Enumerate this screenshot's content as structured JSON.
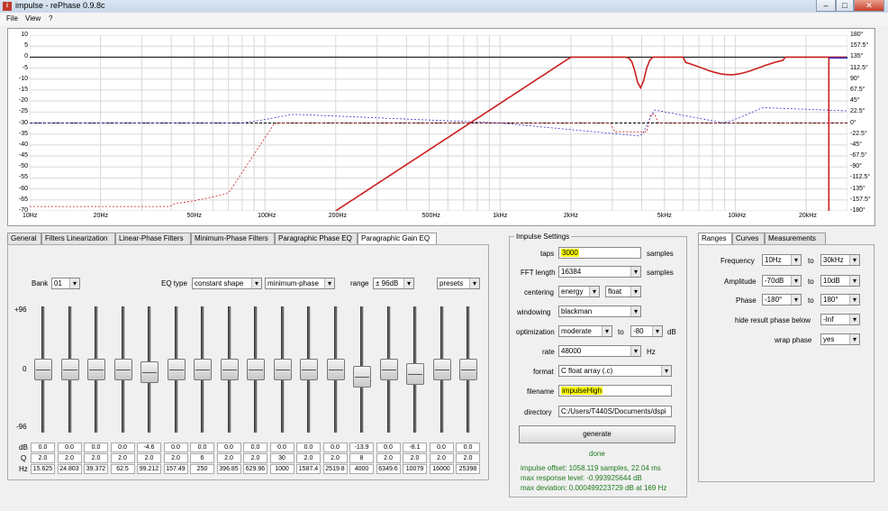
{
  "window": {
    "title": "impulse  -  rePhase 0.9.8c",
    "min_label": "–",
    "max_label": "□",
    "close_label": "✕"
  },
  "menu": [
    "File",
    "View",
    "?"
  ],
  "plot": {
    "y_left_ticks": [
      "10",
      "5",
      "0",
      "-5",
      "-10",
      "-15",
      "-20",
      "-25",
      "-30",
      "-35",
      "-40",
      "-45",
      "-50",
      "-55",
      "-60",
      "-65",
      "-70"
    ],
    "y_right_ticks": [
      "180°",
      "157.5°",
      "135°",
      "112.5°",
      "90°",
      "67.5°",
      "45°",
      "22.5°",
      "0°",
      "-22.5°",
      "-45°",
      "-67.5°",
      "-90°",
      "-112.5°",
      "-135°",
      "-157.5°",
      "-180°"
    ],
    "x_ticks": [
      "10Hz",
      "20Hz",
      "50Hz",
      "100Hz",
      "200Hz",
      "500Hz",
      "1kHz",
      "2kHz",
      "5kHz",
      "10kHz",
      "20kHz"
    ],
    "colors": {
      "red": "#cc1f1f",
      "blue": "#3333cc",
      "grid": "#d8d8d8"
    }
  },
  "tabs": [
    "General",
    "Filters Linearization",
    "Linear-Phase Filters",
    "Minimum-Phase Filters",
    "Paragraphic Phase EQ",
    "Paragraphic Gain EQ"
  ],
  "active_tab": 5,
  "eq": {
    "bank_label": "Bank",
    "bank_value": "01",
    "eqtype_label": "EQ type",
    "eqtype_value": "constant shape",
    "phase_value": "minimum-phase",
    "range_label": "range",
    "range_value": "± 96dB",
    "presets_label": "presets",
    "scale_top": "+96",
    "scale_mid": "0",
    "scale_bottom": "-96",
    "row_labels": {
      "db": "dB",
      "q": "Q",
      "hz": "Hz"
    },
    "bands": [
      {
        "db": "0.0",
        "q": "2.0",
        "hz": "15.625",
        "level": 0
      },
      {
        "db": "0.0",
        "q": "2.0",
        "hz": "24.803",
        "level": 0
      },
      {
        "db": "0.0",
        "q": "2.0",
        "hz": "39.372",
        "level": 0
      },
      {
        "db": "0.0",
        "q": "2.0",
        "hz": "62.5",
        "level": 0
      },
      {
        "db": "-4.6",
        "q": "2.0",
        "hz": "99.212",
        "level": -4.6
      },
      {
        "db": "0.0",
        "q": "2.0",
        "hz": "157.49",
        "level": 0
      },
      {
        "db": "0.0",
        "q": "6",
        "hz": "250",
        "level": 0
      },
      {
        "db": "0.0",
        "q": "2.0",
        "hz": "396.85",
        "level": 0
      },
      {
        "db": "0.0",
        "q": "2.0",
        "hz": "629.96",
        "level": 0
      },
      {
        "db": "0.0",
        "q": "30",
        "hz": "1000",
        "level": 0
      },
      {
        "db": "0.0",
        "q": "2.0",
        "hz": "1587.4",
        "level": 0
      },
      {
        "db": "0.0",
        "q": "2.0",
        "hz": "2519.8",
        "level": 0
      },
      {
        "db": "-13.9",
        "q": "8",
        "hz": "4000",
        "level": -13.9
      },
      {
        "db": "0.0",
        "q": "2.0",
        "hz": "6349.6",
        "level": 0
      },
      {
        "db": "-8.1",
        "q": "2.0",
        "hz": "10079",
        "level": -8.1
      },
      {
        "db": "0.0",
        "q": "2.0",
        "hz": "16000",
        "level": 0
      },
      {
        "db": "0.0",
        "q": "2.0",
        "hz": "25398",
        "level": 0
      }
    ]
  },
  "impulse": {
    "group_title": "Impulse Settings",
    "taps_label": "taps",
    "taps_value": "3000",
    "samples1": "samples",
    "fft_label": "FFT length",
    "fft_value": "16384",
    "samples2": "samples",
    "centering_label": "centering",
    "centering_value": "energy",
    "centering_type": "float",
    "windowing_label": "windowing",
    "windowing_value": "blackman",
    "optim_label": "optimization",
    "optim_value": "moderate",
    "optim_to": "to",
    "optim_db_value": "-80",
    "optim_db": "dB",
    "rate_label": "rate",
    "rate_value": "48000",
    "rate_unit": "Hz",
    "format_label": "format",
    "format_value": "C float array (.c)",
    "filename_label": "filename",
    "filename_value": "impulseHigh",
    "directory_label": "directory",
    "directory_value": "C:/Users/T440S/Documents/dspi",
    "generate_label": "generate",
    "status": "done",
    "offset_text": "impulse offset: 1058.119 samples, 22.04 ms",
    "maxresp_text": "max response level: -0.993925644 dB",
    "maxdev_text": "max deviation: 0.000499223729 dB at 169 Hz"
  },
  "ranges": {
    "tabs": [
      "Ranges",
      "Curves",
      "Measurements"
    ],
    "freq_label": "Frequency",
    "freq_from": "10Hz",
    "freq_to_label": "to",
    "freq_to": "30kHz",
    "amp_label": "Amplitude",
    "amp_from": "-70dB",
    "amp_to_label": "to",
    "amp_to": "10dB",
    "phase_label": "Phase",
    "phase_from": "-180°",
    "phase_to_label": "to",
    "phase_to": "180°",
    "hide_label": "hide result phase below",
    "hide_value": "-Inf",
    "wrap_label": "wrap phase",
    "wrap_value": "yes"
  }
}
